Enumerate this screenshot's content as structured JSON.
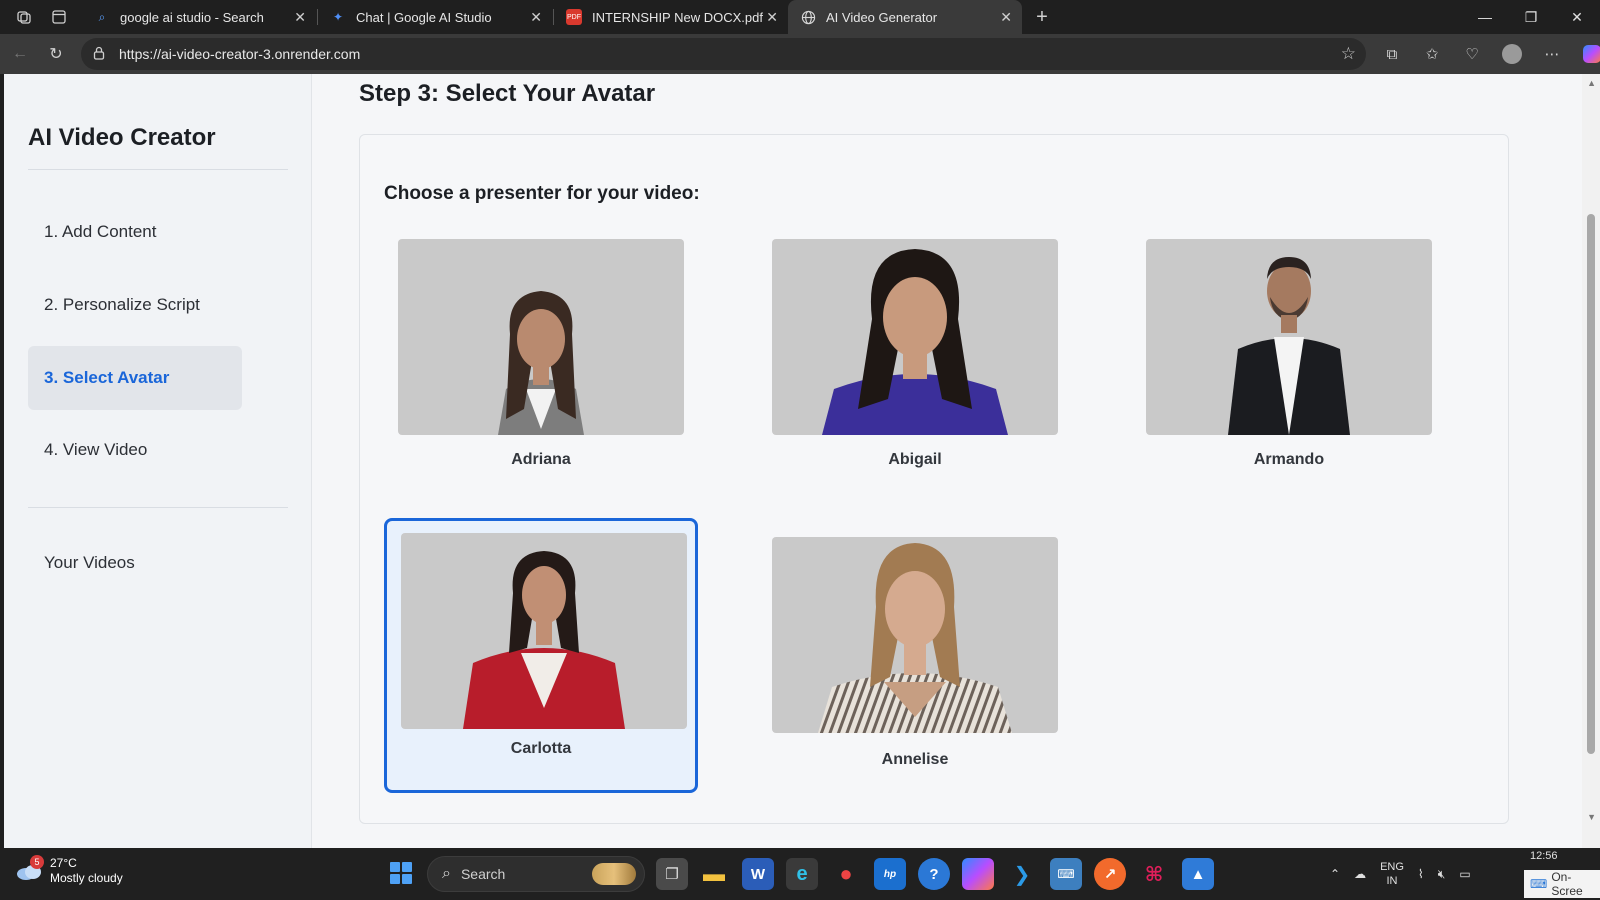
{
  "browser": {
    "tabs": [
      {
        "title": "google ai studio - Search",
        "icon": "search-icon"
      },
      {
        "title": "Chat | Google AI Studio",
        "icon": "ai-studio-icon"
      },
      {
        "title": "INTERNSHIP New DOCX.pdf",
        "icon": "pdf-icon"
      },
      {
        "title": "AI Video Generator",
        "icon": "globe-icon"
      }
    ],
    "url": "https://ai-video-creator-3.onrender.com"
  },
  "sidebar": {
    "brand": "AI Video Creator",
    "steps": [
      {
        "label": "1. Add Content"
      },
      {
        "label": "2. Personalize Script"
      },
      {
        "label": "3. Select Avatar",
        "active": true
      },
      {
        "label": "4. View Video"
      }
    ],
    "your_videos": "Your Videos"
  },
  "main": {
    "step_title": "Step 3: Select Your Avatar",
    "prompt": "Choose a presenter for your video:",
    "avatars": [
      {
        "name": "Adriana",
        "selected": false
      },
      {
        "name": "Abigail",
        "selected": false
      },
      {
        "name": "Armando",
        "selected": false
      },
      {
        "name": "Carlotta",
        "selected": true
      },
      {
        "name": "Annelise",
        "selected": false
      }
    ]
  },
  "taskbar": {
    "weather_badge": "5",
    "temperature": "27°C",
    "condition": "Mostly cloudy",
    "search_placeholder": "Search",
    "lang_line1": "ENG",
    "lang_line2": "IN",
    "time": "12:56",
    "onscreen": "On-Scree"
  },
  "colors": {
    "accent": "#1a66d9",
    "selected_bg": "#e8f1fc",
    "sidebar_bg": "#f1f3f6"
  }
}
